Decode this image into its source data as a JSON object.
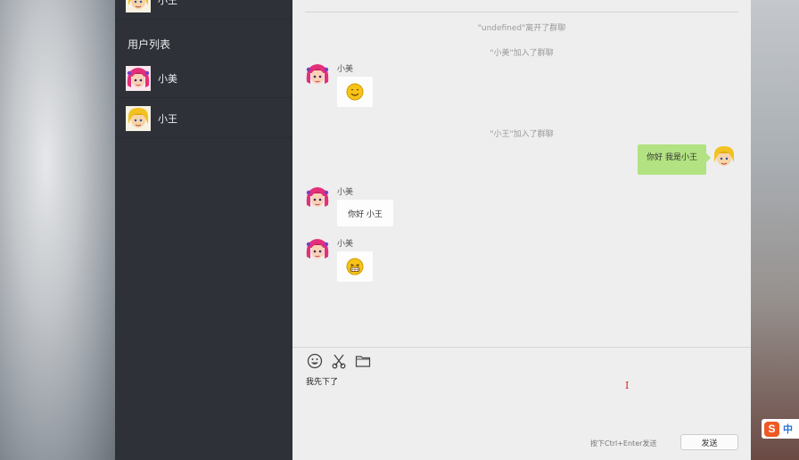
{
  "sidebar": {
    "top_user": {
      "name": "小王",
      "avatar": "blonde-avatar"
    },
    "section_title": "用户列表",
    "users": [
      {
        "name": "小美",
        "avatar": "pink-hair-avatar"
      },
      {
        "name": "小王",
        "avatar": "blonde-avatar"
      }
    ]
  },
  "chat": {
    "system_messages": [
      "\"undefined\"离开了群聊",
      "\"小美\"加入了群聊",
      "\"小王\"加入了群聊"
    ],
    "messages": [
      {
        "sender": "小美",
        "content_type": "emoji",
        "emoji": "smile-emoji"
      },
      {
        "sender": "小王",
        "self": true,
        "text": "你好 我是小王"
      },
      {
        "sender": "小美",
        "text": "你好 小王"
      },
      {
        "sender": "小美",
        "content_type": "emoji",
        "emoji": "grin-emoji"
      }
    ]
  },
  "composer": {
    "tools": [
      "emoji-icon",
      "scissors-icon",
      "folder-icon"
    ],
    "draft_text": "我先下了",
    "hint": "按下Ctrl+Enter发送",
    "send_label": "发送"
  },
  "ime": {
    "logo": "S",
    "mode": "中"
  },
  "colors": {
    "sidebar_bg": "#2e3238",
    "chat_bg": "#eeeeee",
    "self_bubble": "#b2e281",
    "other_bubble": "#fdfdfd",
    "ime_logo": "#ef5a22"
  }
}
